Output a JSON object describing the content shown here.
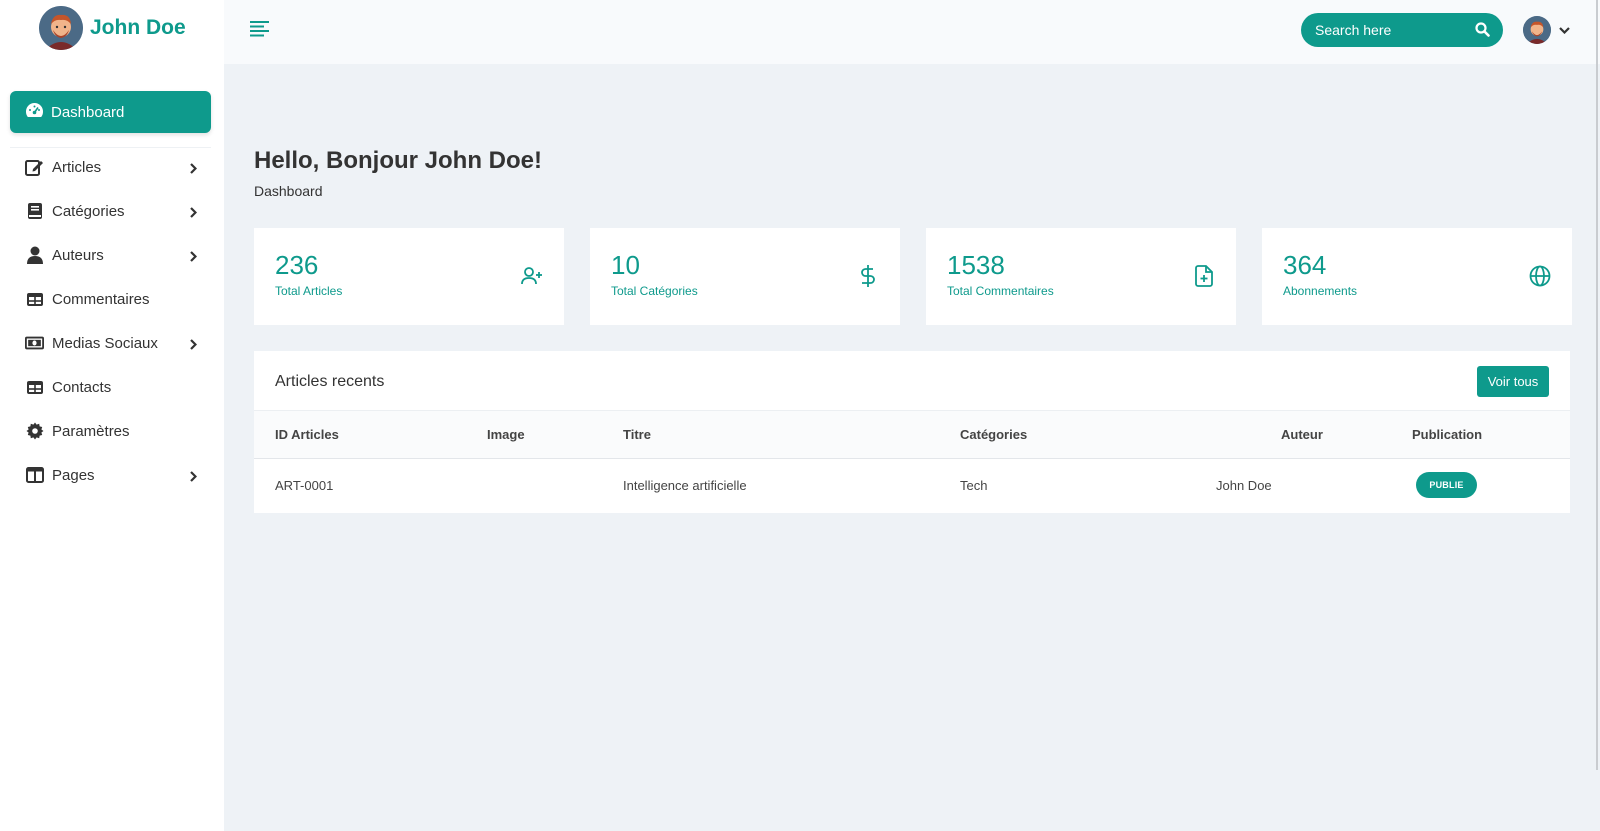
{
  "user": {
    "name": "John Doe"
  },
  "sidebar": {
    "active": {
      "label": "Dashboard",
      "icon": "gauge-icon"
    },
    "items": [
      {
        "label": "Articles",
        "icon": "edit-icon",
        "has_submenu": true
      },
      {
        "label": "Catégories",
        "icon": "book-icon",
        "has_submenu": true
      },
      {
        "label": "Auteurs",
        "icon": "user-icon",
        "has_submenu": true
      },
      {
        "label": "Commentaires",
        "icon": "table-icon",
        "has_submenu": false
      },
      {
        "label": "Medias Sociaux",
        "icon": "money-bill-icon",
        "has_submenu": true
      },
      {
        "label": "Contacts",
        "icon": "table-icon",
        "has_submenu": false
      },
      {
        "label": "Paramètres",
        "icon": "gear-icon",
        "has_submenu": false
      },
      {
        "label": "Pages",
        "icon": "columns-icon",
        "has_submenu": true
      }
    ]
  },
  "topbar": {
    "search_placeholder": "Search here"
  },
  "header": {
    "greeting": "Hello, Bonjour John Doe!",
    "subtitle": "Dashboard"
  },
  "stats": [
    {
      "value": "236",
      "label": "Total Articles",
      "icon": "user-plus-icon"
    },
    {
      "value": "10",
      "label": "Total Catégories",
      "icon": "dollar-icon"
    },
    {
      "value": "1538",
      "label": "Total Commentaires",
      "icon": "file-plus-icon"
    },
    {
      "value": "364",
      "label": "Abonnements",
      "icon": "globe-icon"
    }
  ],
  "recent": {
    "title": "Articles recents",
    "button_label": "Voir tous",
    "columns": [
      "ID Articles",
      "Image",
      "Titre",
      "Catégories",
      "Auteur",
      "Publication"
    ],
    "rows": [
      {
        "id": "ART-0001",
        "image": "",
        "titre": "Intelligence artificielle",
        "categorie": "Tech",
        "auteur": "John Doe",
        "publication": "PUBLIE"
      }
    ]
  },
  "colors": {
    "accent": "#0e9a8c",
    "background": "#eef2f6",
    "sidebar": "#ffffff"
  }
}
